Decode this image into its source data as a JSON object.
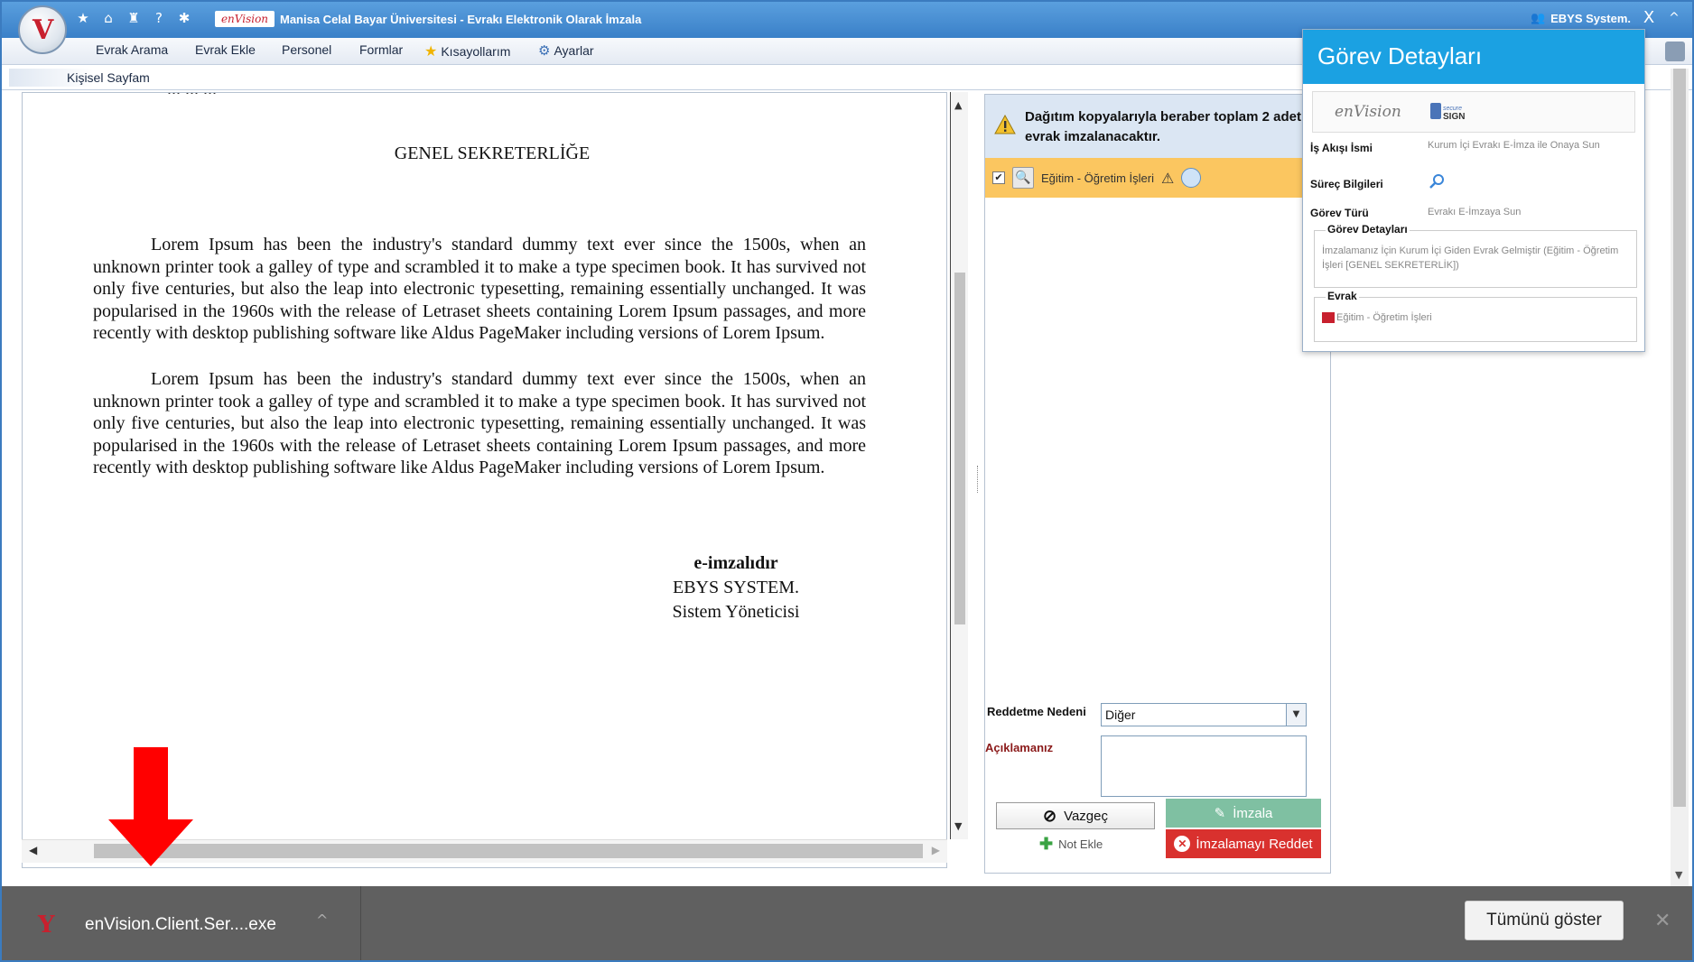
{
  "window": {
    "brand": "enVision",
    "title": "Manisa Celal Bayar Üniversitesi - Evrakı Elektronik Olarak İmzala",
    "user": "EBYS System.",
    "close_label": "X",
    "collapse_label": "^"
  },
  "menu": {
    "items": [
      "Evrak Arama",
      "Evrak Ekle",
      "Personel",
      "Formlar",
      "Kısayollarım",
      "Ayarlar"
    ]
  },
  "breadcrumb": {
    "label": "Kişisel Sayfam"
  },
  "document": {
    "cut_text": "... ... ...",
    "heading": "GENEL SEKRETERLİĞE",
    "paragraphs": [
      "Lorem Ipsum has been the industry's standard dummy text ever since the 1500s, when an unknown printer took a galley of type and scrambled it to make a type specimen book. It has survived not only five centuries, but also the leap into electronic typesetting, remaining essentially unchanged. It was popularised in the 1960s with the release of Letraset sheets containing Lorem Ipsum passages, and more recently with desktop publishing software like Aldus PageMaker including versions of Lorem Ipsum.",
      "Lorem Ipsum has been the industry's standard dummy text ever since the 1500s, when an unknown printer took a galley of type and scrambled it to make a type specimen book. It has survived not only five centuries, but also the leap into electronic typesetting, remaining essentially unchanged. It was popularised in the 1960s with the release of Letraset sheets containing Lorem Ipsum passages, and more recently with desktop publishing software like Aldus PageMaker including versions of Lorem Ipsum."
    ],
    "signature": {
      "status": "e-imzalıdır",
      "name": "EBYS SYSTEM.",
      "role": "Sistem Yöneticisi"
    }
  },
  "sign_panel": {
    "warning": "Dağıtım kopyalarıyla beraber toplam 2 adet evrak imzalanacaktır.",
    "document_row": {
      "checked": true,
      "label": "Eğitim - Öğretim İşleri"
    },
    "reject_reason_label": "Reddetme Nedeni",
    "reject_reason_value": "Diğer",
    "note_label": "Açıklamanız",
    "note_value": "",
    "cancel_label": "Vazgeç",
    "sign_label": "İmzala",
    "add_note_label": "Not Ekle",
    "reject_label": "İmzalamayı Reddet"
  },
  "task_popup": {
    "title": "Görev Detayları",
    "logo_text": "enVision",
    "secure_text": "SIGN",
    "secure_small": "secure",
    "workflow_label": "İş Akışı İsmi",
    "workflow_value": "Kurum İçi Evrakı E-İmza ile Onaya Sun",
    "process_label": "Süreç Bilgileri",
    "task_type_label": "Görev Türü",
    "task_type_value": "Evrakı E-İmzaya Sun",
    "details_legend": "Görev Detayları",
    "details_text": "İmzalamanız İçin Kurum İçi Giden Evrak Gelmiştir (Eğitim - Öğretim İşleri [GENEL SEKRETERLİK])",
    "doc_legend": "Evrak",
    "doc_text": "Eğitim - Öğretim İşleri"
  },
  "download_bar": {
    "file_name": "enVision.Client.Ser....exe",
    "show_all_label": "Tümünü göster",
    "close_label": "✕"
  },
  "colors": {
    "titlebar": "#3a80c8",
    "popup_header": "#1ba1e2",
    "selected_row": "#fbc660",
    "sign_button": "#7fc0a2",
    "reject_button": "#d9312e",
    "arrow": "#ff0000"
  }
}
